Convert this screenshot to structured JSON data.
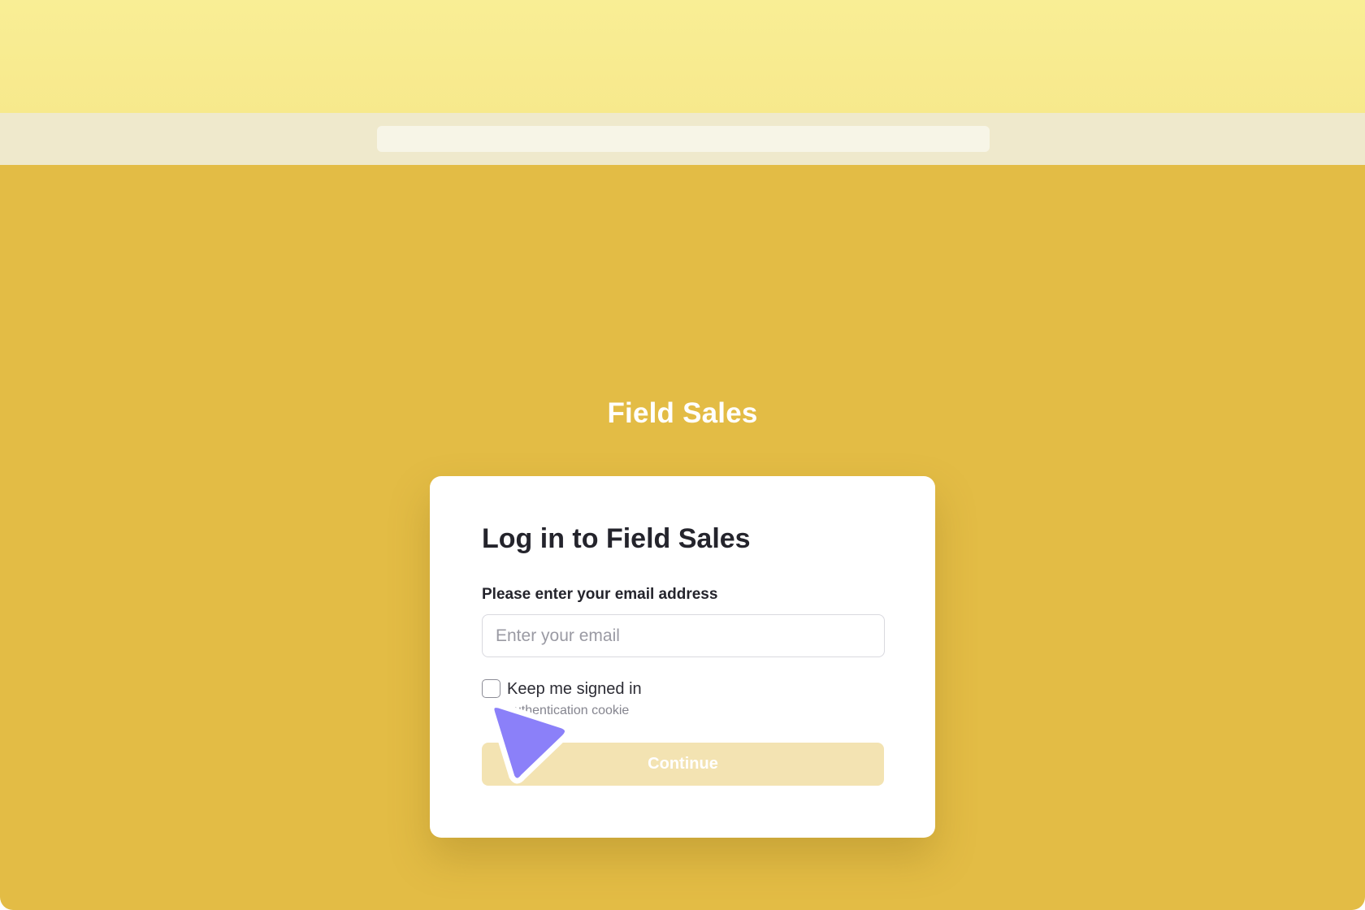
{
  "app": {
    "title": "Field Sales"
  },
  "login": {
    "heading": "Log in to Field Sales",
    "email_label": "Please enter your email address",
    "email_placeholder": "Enter your email",
    "email_value": "",
    "keep_signed_in_label": "Keep me signed in",
    "keep_signed_in_checked": false,
    "helper_text": "authentication cookie",
    "continue_label": "Continue",
    "continue_enabled": false
  },
  "colors": {
    "background": "#e3bc45",
    "top_band": "#f9ee95",
    "card": "#ffffff",
    "button_disabled": "#f3e3b2",
    "cursor": "#8b80f9"
  },
  "icons": {
    "cursor": "pointer-arrow-icon"
  }
}
